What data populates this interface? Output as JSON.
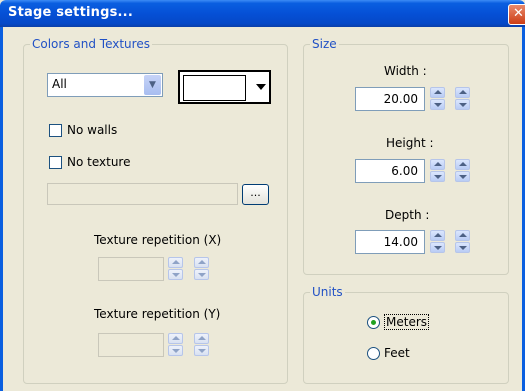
{
  "window": {
    "title": "Stage settings..."
  },
  "colors_textures": {
    "legend": "Colors and Textures",
    "surface_select": "All",
    "no_walls_label": "No walls",
    "no_texture_label": "No texture",
    "texture_path": "",
    "browse_label": "...",
    "repetition_x_label": "Texture repetition (X)",
    "repetition_x_value": "",
    "repetition_y_label": "Texture repetition (Y)",
    "repetition_y_value": ""
  },
  "size": {
    "legend": "Size",
    "width_label": "Width :",
    "width_value": "20.00",
    "height_label": "Height :",
    "height_value": "6.00",
    "depth_label": "Depth :",
    "depth_value": "14.00"
  },
  "units": {
    "legend": "Units",
    "meters_label": "Meters",
    "feet_label": "Feet",
    "selected": "Meters"
  },
  "colors": {
    "title_bar": "#0550d6",
    "dialog_bg": "#ece9d8",
    "group_label": "#2151c5"
  }
}
